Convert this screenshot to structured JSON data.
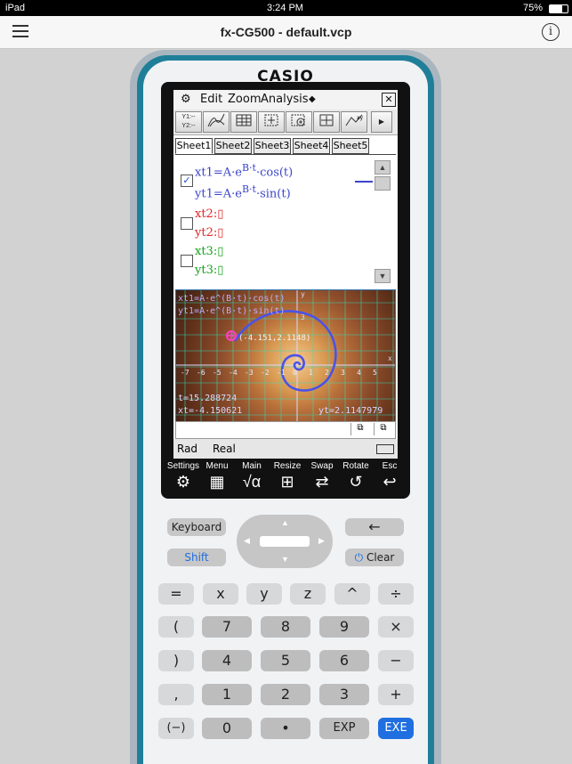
{
  "status_bar": {
    "device": "iPad",
    "time": "3:24 PM",
    "battery": "75%"
  },
  "nav": {
    "title": "fx-CG500 - default.vcp",
    "menu_icon": "hamburger-icon",
    "info_icon": "info-icon",
    "info_glyph": "i"
  },
  "calculator": {
    "brand": "CASIO"
  },
  "app_menu": {
    "gear_glyph": "⚙",
    "edit": "Edit",
    "zoom": "Zoom",
    "analysis": "Analysis",
    "dropdown_glyph": "◆",
    "close_glyph": "✕"
  },
  "toolbar": {
    "first_label": "Y1:--\nY2:--",
    "more_glyph": "▶"
  },
  "sheets": [
    "Sheet1",
    "Sheet2",
    "Sheet3",
    "Sheet4",
    "Sheet5"
  ],
  "equations": {
    "xt1": "xt1=A·e",
    "xt1_exp": "B·t",
    "xt1_tail": "·cos(t)",
    "yt1": "yt1=A·e",
    "yt1_exp": "B·t",
    "yt1_tail": "·sin(t)",
    "xt2": "xt2:▯",
    "yt2": "yt2:▯",
    "xt3": "xt3:▯",
    "yt3": "yt3:▯",
    "check_mark": "✓",
    "colors": {
      "pair1": "#3a44c9",
      "pair2": "#e02424",
      "pair3": "#15a11a"
    }
  },
  "graph": {
    "line1": "xt1=A·e^(B·t)·cos(t)",
    "line2": "yt1=A·e^(B·t)·sin(t)",
    "point_label": "(-4.151,2.1148)",
    "t_readout": "t=15.288724",
    "x_readout": "xt=-4.150621",
    "y_readout": "yt=2.1147979",
    "x_ticks": [
      "-7",
      "-6",
      "-5",
      "-4",
      "-3",
      "-2",
      "-1",
      "0",
      "1",
      "2",
      "3",
      "4",
      "5"
    ],
    "x_axis_label": "x",
    "y_axis_label": "y",
    "y_tick_3": "3"
  },
  "lcd_status": {
    "angle": "Rad",
    "mode": "Real"
  },
  "icon_bar": [
    {
      "label": "Settings",
      "glyph": "⚙",
      "icon": "gear-icon"
    },
    {
      "label": "Menu",
      "glyph": "▦",
      "icon": "grid-menu-icon"
    },
    {
      "label": "Main",
      "glyph": "√α",
      "icon": "main-icon"
    },
    {
      "label": "Resize",
      "glyph": "⊞",
      "icon": "resize-icon"
    },
    {
      "label": "Swap",
      "glyph": "⇄",
      "icon": "swap-icon"
    },
    {
      "label": "Rotate",
      "glyph": "↺",
      "icon": "rotate-icon"
    },
    {
      "label": "Esc",
      "glyph": "↩",
      "icon": "escape-icon"
    }
  ],
  "keys": {
    "keyboard": "Keyboard",
    "shift": "Shift",
    "backspace": "←",
    "clear": "Clear",
    "power_glyph": "⏻",
    "dpad": {
      "up": "▲",
      "down": "▼",
      "left": "◀",
      "right": "▶"
    },
    "row1": [
      "=",
      "x",
      "y",
      "z",
      "^",
      "÷"
    ],
    "row2": [
      "(",
      "7",
      "8",
      "9",
      "×"
    ],
    "row3": [
      ")",
      "4",
      "5",
      "6",
      "−"
    ],
    "row4": [
      ",",
      "1",
      "2",
      "3",
      "+"
    ],
    "row5": [
      "(−)",
      "0",
      "•",
      "EXP",
      "EXE"
    ]
  }
}
